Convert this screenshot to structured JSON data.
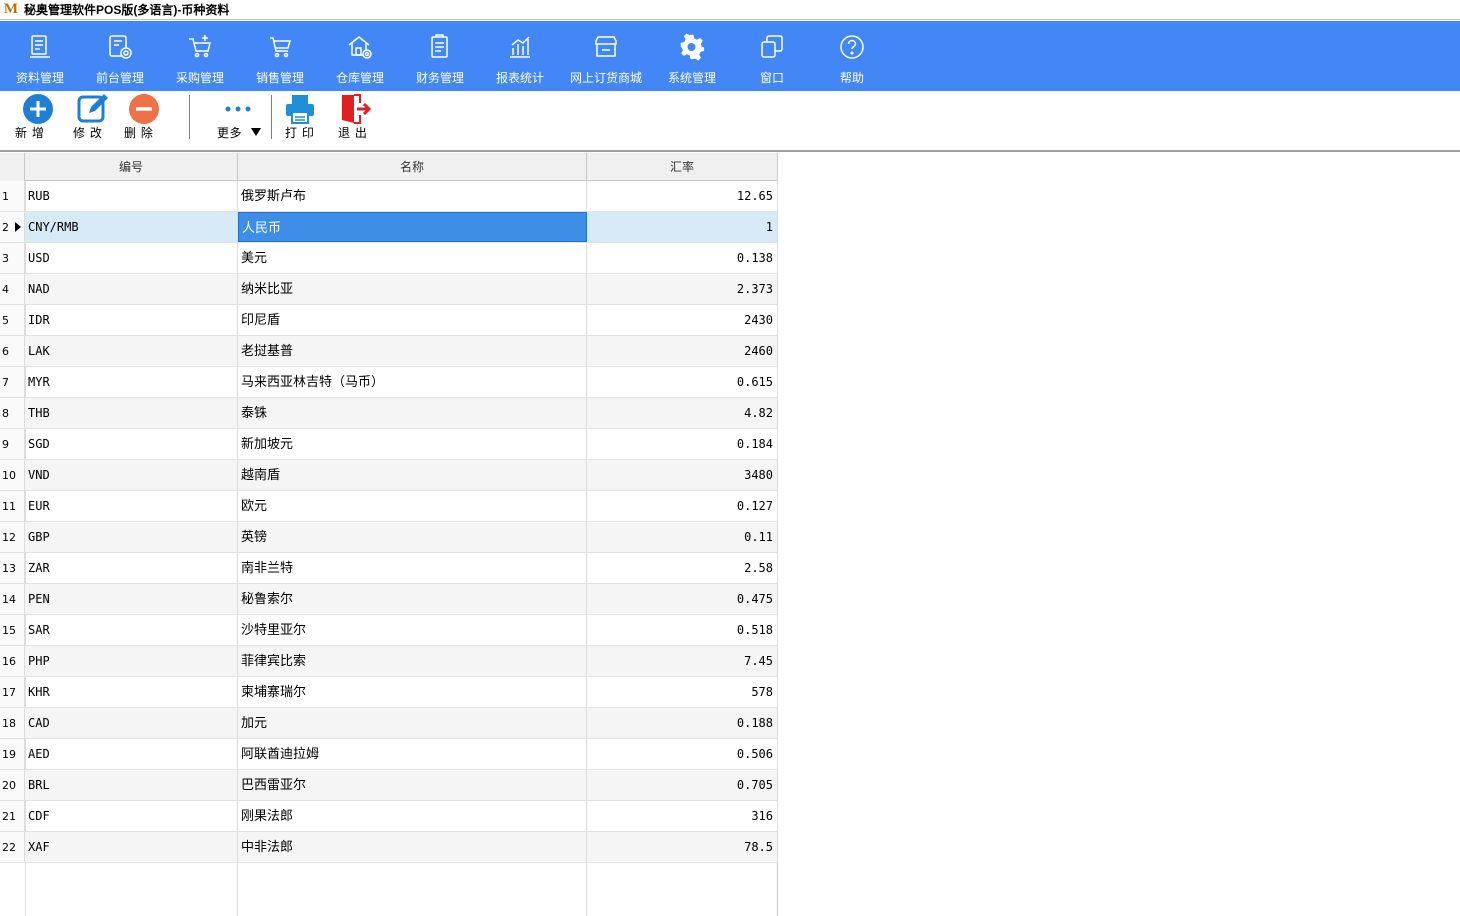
{
  "window": {
    "title": "秘奥管理软件POS版(多语言)-币种资料",
    "logo_text": "M"
  },
  "menu": [
    {
      "label": "资料管理",
      "icon": "document-icon"
    },
    {
      "label": "前台管理",
      "icon": "pos-settings-icon"
    },
    {
      "label": "采购管理",
      "icon": "cart-add-icon"
    },
    {
      "label": "销售管理",
      "icon": "cart-icon"
    },
    {
      "label": "仓库管理",
      "icon": "warehouse-icon"
    },
    {
      "label": "财务管理",
      "icon": "finance-doc-icon"
    },
    {
      "label": "报表统计",
      "icon": "bar-chart-icon"
    },
    {
      "label": "网上订货商城",
      "icon": "store-icon"
    },
    {
      "label": "系统管理",
      "icon": "gear-icon"
    },
    {
      "label": "窗口",
      "icon": "windows-icon"
    },
    {
      "label": "帮助",
      "icon": "help-icon"
    }
  ],
  "toolbar": {
    "add_label": "新 增",
    "edit_label": "修 改",
    "delete_label": "删 除",
    "more_label": "更多",
    "print_label": "打 印",
    "exit_label": "退 出"
  },
  "table": {
    "headers": {
      "code": "编号",
      "name": "名称",
      "rate": "汇率"
    },
    "selected_row": 2,
    "rows": [
      {
        "idx": "1",
        "code": "RUB",
        "name": "俄罗斯卢布",
        "rate": "12.65"
      },
      {
        "idx": "2",
        "code": "CNY/RMB",
        "name": "人民币",
        "rate": "1"
      },
      {
        "idx": "3",
        "code": "USD",
        "name": "美元",
        "rate": "0.138"
      },
      {
        "idx": "4",
        "code": "NAD",
        "name": "纳米比亚",
        "rate": "2.373"
      },
      {
        "idx": "5",
        "code": "IDR",
        "name": "印尼盾",
        "rate": "2430"
      },
      {
        "idx": "6",
        "code": "LAK",
        "name": "老挝基普",
        "rate": "2460"
      },
      {
        "idx": "7",
        "code": "MYR",
        "name": "马来西亚林吉特（马币）",
        "rate": "0.615"
      },
      {
        "idx": "8",
        "code": "THB",
        "name": "泰铢",
        "rate": "4.82"
      },
      {
        "idx": "9",
        "code": "SGD",
        "name": "新加坡元",
        "rate": "0.184"
      },
      {
        "idx": "10",
        "code": "VND",
        "name": "越南盾",
        "rate": "3480"
      },
      {
        "idx": "11",
        "code": "EUR",
        "name": "欧元",
        "rate": "0.127"
      },
      {
        "idx": "12",
        "code": "GBP",
        "name": "英镑",
        "rate": "0.11"
      },
      {
        "idx": "13",
        "code": "ZAR",
        "name": "南非兰特",
        "rate": "2.58"
      },
      {
        "idx": "14",
        "code": "PEN",
        "name": "秘鲁索尔",
        "rate": "0.475"
      },
      {
        "idx": "15",
        "code": "SAR",
        "name": "沙特里亚尔",
        "rate": "0.518"
      },
      {
        "idx": "16",
        "code": "PHP",
        "name": "菲律宾比索",
        "rate": "7.45"
      },
      {
        "idx": "17",
        "code": "KHR",
        "name": "柬埔寨瑞尔",
        "rate": "578"
      },
      {
        "idx": "18",
        "code": "CAD",
        "name": "加元",
        "rate": "0.188"
      },
      {
        "idx": "19",
        "code": "AED",
        "name": "阿联酋迪拉姆",
        "rate": "0.506"
      },
      {
        "idx": "20",
        "code": "BRL",
        "name": "巴西雷亚尔",
        "rate": "0.705"
      },
      {
        "idx": "21",
        "code": "CDF",
        "name": "刚果法郎",
        "rate": "316"
      },
      {
        "idx": "22",
        "code": "XAF",
        "name": "中非法郎",
        "rate": "78.5"
      }
    ]
  },
  "colors": {
    "menubar": "#4287f5",
    "add": "#1f7fd6",
    "edit": "#1f7fd6",
    "delete": "#f07048",
    "print": "#1f8fd8",
    "exit": "#e02020",
    "selection": "#3d8ee6"
  }
}
